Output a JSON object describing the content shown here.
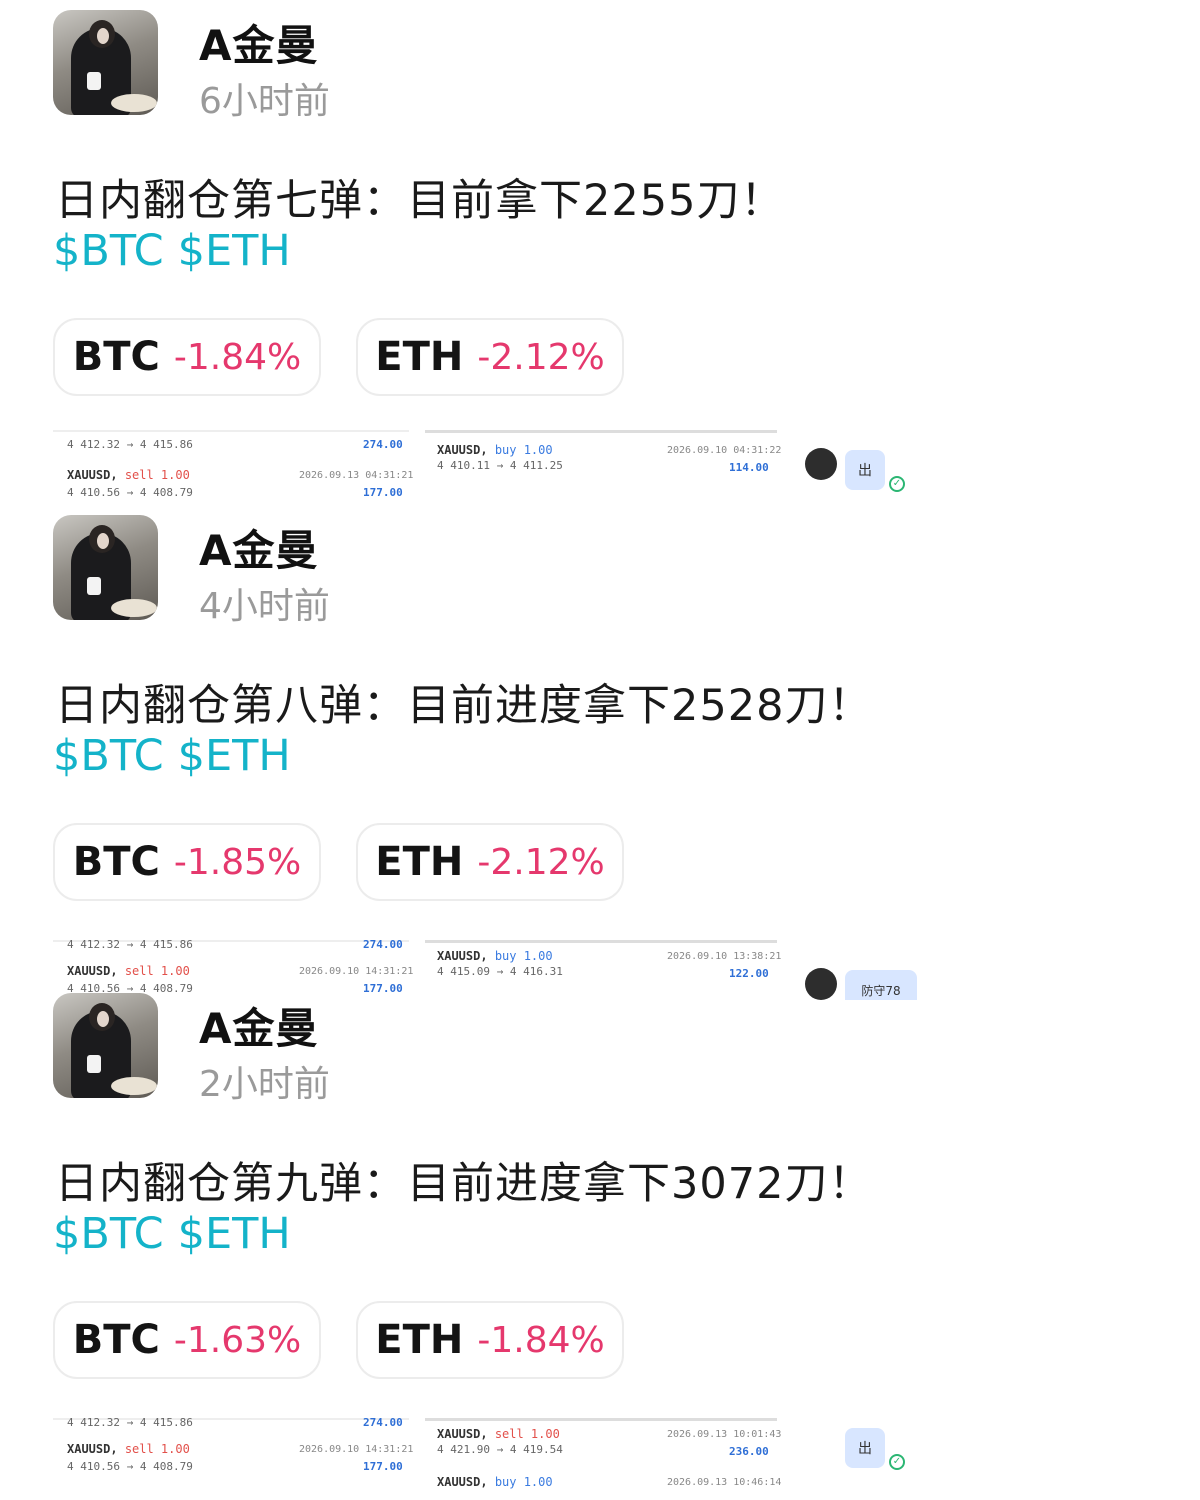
{
  "posts": [
    {
      "author": "A金曼",
      "time": "6小时前",
      "text": "日内翻仓第七弹：目前拿下2255刀！",
      "tags": [
        "$BTC",
        "$ETH"
      ],
      "tickers": [
        {
          "symbol": "BTC",
          "change": "-1.84%"
        },
        {
          "symbol": "ETH",
          "change": "-2.12%"
        }
      ],
      "preview": {
        "left_line1": "4 412.32 → 4 415.86",
        "left_val1": "274.00",
        "left_sym": "XAUUSD,",
        "left_side": "sell 1.00",
        "left_date": "2026.09.13 04:31:21",
        "left_line2": "4 410.56 → 4 408.79",
        "left_val2": "177.00",
        "mid_sym": "XAUUSD,",
        "mid_side": "buy 1.00",
        "mid_date": "2026.09.10 04:31:22",
        "mid_line": "4 410.11 → 4 411.25",
        "mid_val": "114.00",
        "chat": "出"
      }
    },
    {
      "author": "A金曼",
      "time": "4小时前",
      "text": "日内翻仓第八弹：目前进度拿下2528刀！",
      "tags": [
        "$BTC",
        "$ETH"
      ],
      "tickers": [
        {
          "symbol": "BTC",
          "change": "-1.85%"
        },
        {
          "symbol": "ETH",
          "change": "-2.12%"
        }
      ],
      "preview": {
        "left_line1": "4 412.32 → 4 415.86",
        "left_val1": "274.00",
        "left_sym": "XAUUSD,",
        "left_side": "sell 1.00",
        "left_date": "2026.09.10 14:31:21",
        "left_line2": "4 410.56 → 4 408.79",
        "left_val2": "177.00",
        "mid_sym": "XAUUSD,",
        "mid_side": "buy 1.00",
        "mid_date": "2026.09.10 13:38:21",
        "mid_line": "4 415.09 → 4 416.31",
        "mid_val": "122.00",
        "chat": "防守78"
      }
    },
    {
      "author": "A金曼",
      "time": "2小时前",
      "text": "日内翻仓第九弹：目前进度拿下3072刀！",
      "tags": [
        "$BTC",
        "$ETH"
      ],
      "tickers": [
        {
          "symbol": "BTC",
          "change": "-1.63%"
        },
        {
          "symbol": "ETH",
          "change": "-1.84%"
        }
      ],
      "preview": {
        "left_line1": "4 412.32 → 4 415.86",
        "left_val1": "274.00",
        "left_sym": "XAUUSD,",
        "left_side": "sell 1.00",
        "left_date": "2026.09.10 14:31:21",
        "left_line2": "4 410.56 → 4 408.79",
        "left_val2": "177.00",
        "mid_sym": "XAUUSD,",
        "mid_side": "sell 1.00",
        "mid_date": "2026.09.13 10:01:43",
        "mid_line": "4 421.90 → 4 419.54",
        "mid_val": "236.00",
        "mid_sym2": "XAUUSD,",
        "mid_side2": "buy 1.00",
        "mid_date2": "2026.09.13 10:46:14",
        "chat": "出"
      }
    }
  ]
}
